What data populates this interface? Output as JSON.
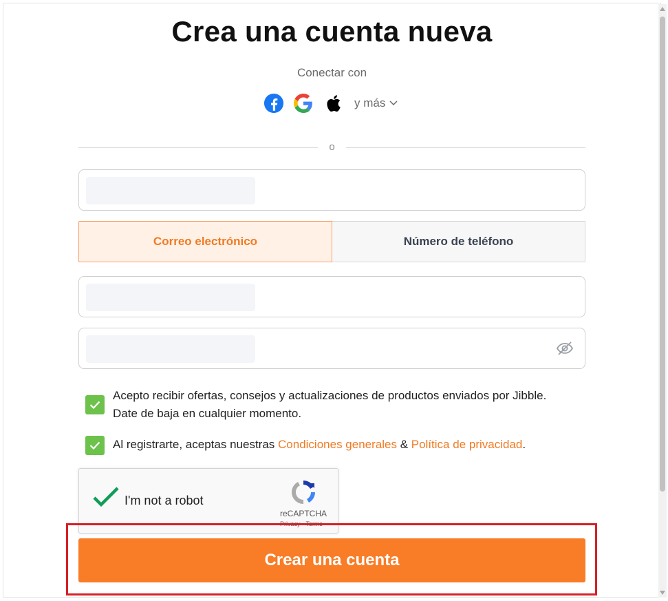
{
  "page": {
    "title": "Crea una cuenta nueva",
    "connect_label": "Conectar con",
    "more_label": "y más",
    "divider_label": "o"
  },
  "social": [
    {
      "name": "facebook",
      "icon": "facebook-icon",
      "color": "#1877F2"
    },
    {
      "name": "google",
      "icon": "google-icon"
    },
    {
      "name": "apple",
      "icon": "apple-icon",
      "color": "#000000"
    }
  ],
  "form": {
    "name_value": "",
    "email_value": "",
    "password_value": "",
    "tab_email": "Correo electrónico",
    "tab_phone": "Número de teléfono",
    "active_tab": "email"
  },
  "consents": {
    "offers_line1": "Acepto recibir ofertas, consejos y actualizaciones de productos enviados por Jibble.",
    "offers_line2": "Date de baja en cualquier momento.",
    "terms_prefix": "Al registrarte, aceptas nuestras ",
    "terms_link": "Condiciones generales",
    "terms_amp": " & ",
    "privacy_link": "Política de privacidad",
    "terms_suffix": ".",
    "offers_checked": true,
    "terms_checked": true
  },
  "recaptcha": {
    "label": "I'm not a robot",
    "brand": "reCAPTCHA",
    "terms": "Privacy - Terms",
    "checked": true
  },
  "cta": {
    "label": "Crear una cuenta"
  },
  "colors": {
    "accent": "#F97C26",
    "check_green": "#6CC24A",
    "highlight": "#D61F26"
  }
}
